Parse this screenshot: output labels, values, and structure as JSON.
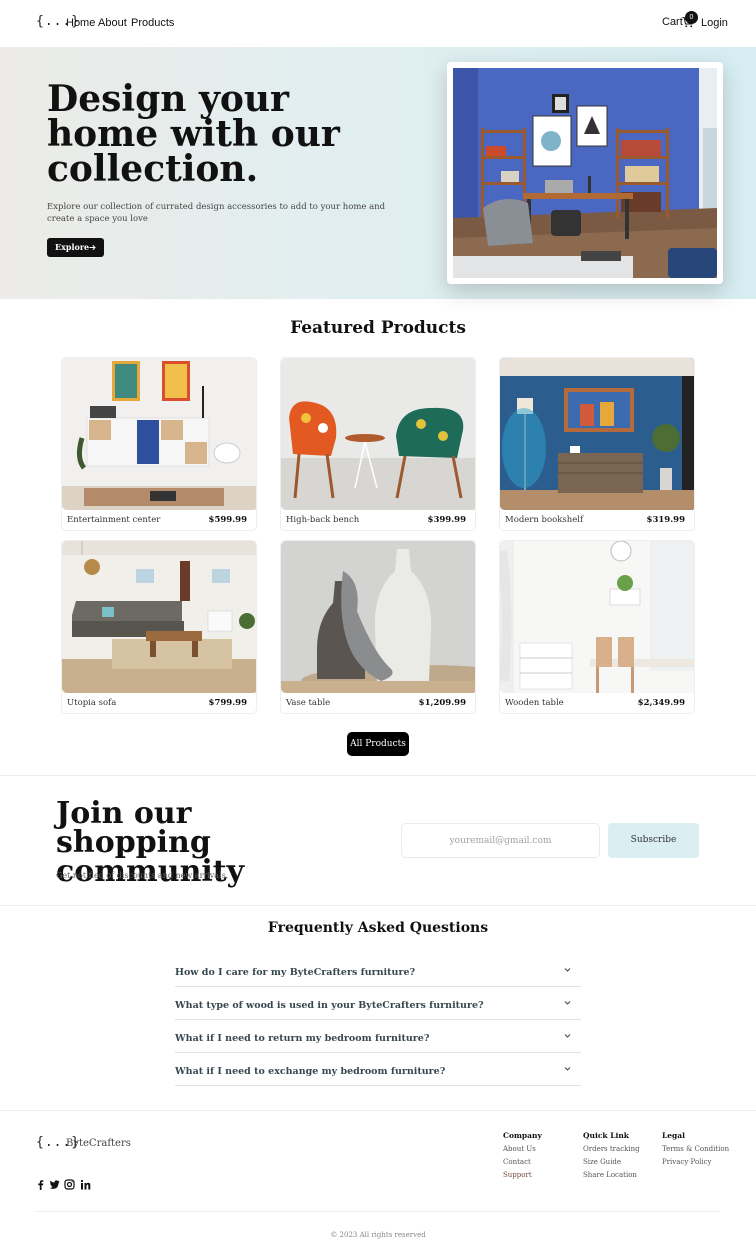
{
  "nav": {
    "logo": "{...}",
    "links": [
      "Home",
      "About",
      "Products"
    ],
    "cart_label": "Cart",
    "cart_count": "0",
    "login_label": "Login"
  },
  "hero": {
    "title": "Design your home with our collection.",
    "description": "Explore our collection of currated design accessories to add to your home and create a space you love",
    "button_label": "Explore",
    "button_icon": "arrow-right-icon"
  },
  "featured": {
    "title": "Featured Products",
    "products": [
      {
        "name": "Entertainment center",
        "price": "$599.99"
      },
      {
        "name": "High-back bench",
        "price": "$399.99"
      },
      {
        "name": "Modern bookshelf",
        "price": "$319.99"
      },
      {
        "name": "Utopia sofa",
        "price": "$799.99"
      },
      {
        "name": "Vase table",
        "price": "$1,209.99"
      },
      {
        "name": "Wooden table",
        "price": "$2,349.99"
      }
    ],
    "all_button": "All Products"
  },
  "newsletter": {
    "title": "Join our shopping community",
    "subtitle": "Get notified of discounts and new arrivals.",
    "email_placeholder": "youremail@gmail.com",
    "button_label": "Subscribe"
  },
  "faq": {
    "title": "Frequently Asked Questions",
    "questions": [
      "How do I care for my ByteCrafters furniture?",
      "What type of wood is used in your ByteCrafters furniture?",
      "What if I need to return my bedroom furniture?",
      "What if I need to exchange my bedroom furniture?"
    ]
  },
  "footer": {
    "logo": "{...}",
    "brand": "ByteCrafters",
    "social_icons": [
      "facebook-icon",
      "twitter-icon",
      "instagram-icon",
      "linkedin-icon"
    ],
    "columns": [
      {
        "title": "Company",
        "links": [
          "About Us",
          "Contact",
          "Support"
        ]
      },
      {
        "title": "Quick Link",
        "links": [
          "Orders tracking",
          "Size Guide",
          "Share Location"
        ]
      },
      {
        "title": "Legal",
        "links": [
          "Terms & Condition",
          "Privacy Policy"
        ]
      }
    ],
    "copyright": "© 2023 All rights reserved"
  },
  "colors": {
    "accent_dark": "#111111",
    "hero_bg": "#e1eef0",
    "subscribe_bg": "#dbeef1",
    "faq_text": "#37474f"
  }
}
